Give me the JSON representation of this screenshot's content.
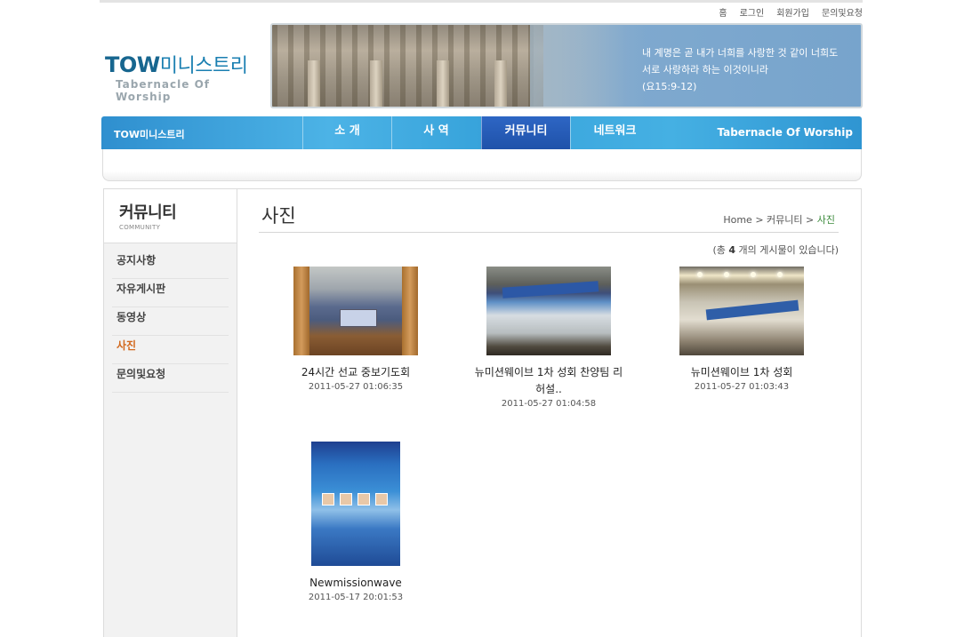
{
  "util_links": [
    "홈",
    "로그인",
    "회원가입",
    "문의및요청"
  ],
  "logo": {
    "main_en": "TOW",
    "main_ko": "미니스트리",
    "sub": "Tabernacle Of Worship"
  },
  "banner": {
    "line1": "내 계명은 곧 내가 너희를 사랑한 것 같이 너희도",
    "line2": "서로 사랑하라 하는 이것이니라",
    "line3": "(요15:9-12)"
  },
  "nav": {
    "brand": "TOW미니스트리",
    "tagline": "Tabernacle Of Worship",
    "items": [
      "소 개",
      "사 역",
      "커뮤니티",
      "네트워크"
    ],
    "active_index": 2
  },
  "sidebar": {
    "title": "커뮤니티",
    "subtitle": "COMMUNITY",
    "items": [
      "공지사항",
      "자유게시판",
      "동영상",
      "사진",
      "문의및요청"
    ],
    "current_index": 3
  },
  "content": {
    "title": "사진",
    "breadcrumb": {
      "home": "Home",
      "sep": ">",
      "section": "커뮤니티",
      "current": "사진"
    },
    "count_prefix": "(총",
    "count_value": "4",
    "count_suffix": "개의 게시물이 있습니다)"
  },
  "gallery": [
    {
      "title": "24시간 선교 중보기도회",
      "date": "2011-05-27 01:06:35",
      "thumb": "hall-stage-icon"
    },
    {
      "title": "뉴미션웨이브 1차 성회 찬양팀 리허설..",
      "date": "2011-05-27 01:04:58",
      "thumb": "praise-team-icon"
    },
    {
      "title": "뉴미션웨이브 1차 성회",
      "date": "2011-05-27 01:03:43",
      "thumb": "conference-hall-icon"
    },
    {
      "title": "Newmissionwave",
      "date": "2011-05-17 20:01:53",
      "thumb": "poster-icon"
    }
  ],
  "colors": {
    "nav_blue": "#45b0e3",
    "nav_active": "#2e66c4",
    "sidebar_current": "#d2691e",
    "breadcrumb_current": "#3a8a3a"
  }
}
